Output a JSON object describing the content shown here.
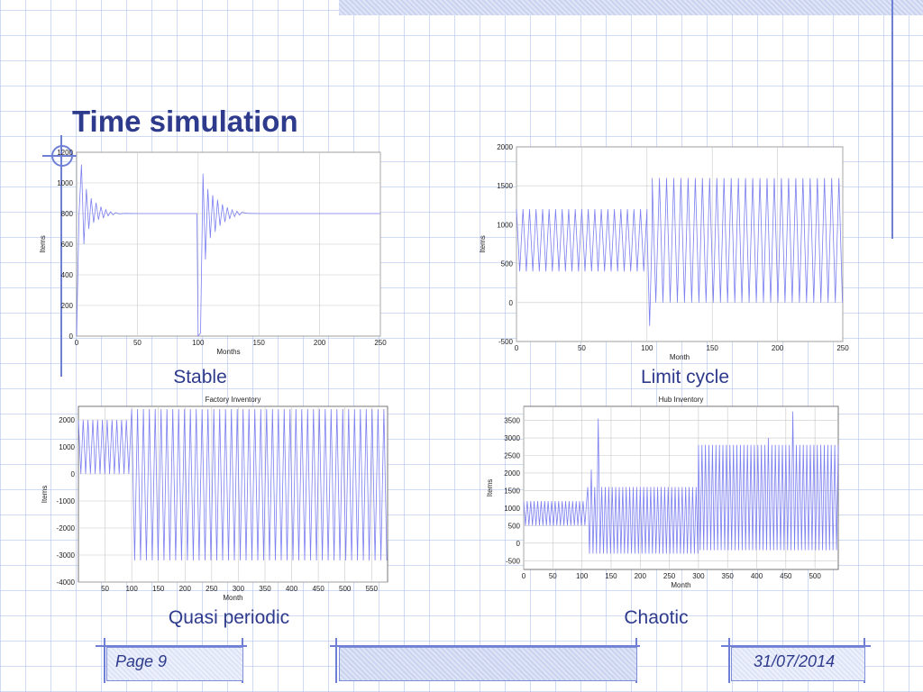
{
  "slide": {
    "title": "Time simulation",
    "page_label": "Page 9",
    "date": "31/07/2014",
    "accent_color": "#2e3a8c",
    "line_color": "#7b7ff0"
  },
  "chart_data": [
    {
      "type": "line",
      "caption": "Stable",
      "title": "",
      "xlabel": "Months",
      "ylabel": "Items",
      "xlim": [
        0,
        250
      ],
      "ylim": [
        0,
        1200
      ],
      "xticks": [
        0,
        50,
        100,
        150,
        200,
        250
      ],
      "yticks": [
        0,
        200,
        400,
        600,
        800,
        1000,
        1200
      ],
      "grid": true,
      "points": [
        [
          0,
          0
        ],
        [
          2,
          800
        ],
        [
          4,
          1120
        ],
        [
          6,
          600
        ],
        [
          8,
          960
        ],
        [
          10,
          700
        ],
        [
          12,
          900
        ],
        [
          14,
          740
        ],
        [
          16,
          870
        ],
        [
          18,
          760
        ],
        [
          20,
          845
        ],
        [
          22,
          770
        ],
        [
          24,
          825
        ],
        [
          26,
          785
        ],
        [
          28,
          812
        ],
        [
          30,
          792
        ],
        [
          32,
          806
        ],
        [
          35,
          798
        ],
        [
          40,
          801
        ],
        [
          50,
          800
        ],
        [
          60,
          800
        ],
        [
          80,
          800
        ],
        [
          99,
          800
        ],
        [
          100,
          0
        ],
        [
          102,
          20
        ],
        [
          104,
          1060
        ],
        [
          106,
          500
        ],
        [
          108,
          960
        ],
        [
          110,
          640
        ],
        [
          112,
          920
        ],
        [
          114,
          680
        ],
        [
          116,
          890
        ],
        [
          118,
          720
        ],
        [
          120,
          860
        ],
        [
          122,
          745
        ],
        [
          124,
          840
        ],
        [
          126,
          765
        ],
        [
          128,
          825
        ],
        [
          130,
          780
        ],
        [
          132,
          815
        ],
        [
          134,
          790
        ],
        [
          136,
          808
        ],
        [
          140,
          802
        ],
        [
          150,
          800
        ],
        [
          200,
          800
        ],
        [
          250,
          800
        ]
      ]
    },
    {
      "type": "line",
      "caption": "Limit cycle",
      "title": "",
      "xlabel": "Month",
      "ylabel": "Items",
      "xlim": [
        0,
        250
      ],
      "ylim": [
        -500,
        2000
      ],
      "xticks": [
        0,
        50,
        100,
        150,
        200,
        250
      ],
      "yticks": [
        -500,
        0,
        500,
        1000,
        1500,
        2000
      ],
      "grid": true,
      "segments": [
        {
          "x_start": 0,
          "x_end": 100,
          "period": 5,
          "min": 400,
          "max": 1200
        },
        {
          "x_start": 100,
          "x_end": 104,
          "period": 4,
          "min": -300,
          "max": 1000
        },
        {
          "x_start": 104,
          "x_end": 250,
          "period": 5.5,
          "min": 0,
          "max": 1600
        }
      ]
    },
    {
      "type": "line",
      "caption": "Quasi periodic",
      "title": "Factory Inventory",
      "xlabel": "Month",
      "ylabel": "Items",
      "xlim": [
        0,
        580
      ],
      "ylim": [
        -4000,
        2500
      ],
      "xticks": [
        50,
        100,
        150,
        200,
        250,
        300,
        350,
        400,
        450,
        500,
        550
      ],
      "yticks": [
        -4000,
        -3000,
        -2000,
        -1000,
        0,
        1000,
        2000
      ],
      "grid": true,
      "segments": [
        {
          "x_start": 0,
          "x_end": 100,
          "period": 9,
          "min": 0,
          "max": 2000
        },
        {
          "x_start": 100,
          "x_end": 580,
          "period": 11,
          "min": -3200,
          "max": 2400
        }
      ]
    },
    {
      "type": "line",
      "caption": "Chaotic",
      "title": "Hub Inventory",
      "xlabel": "Month",
      "ylabel": "Items",
      "xlim": [
        0,
        540
      ],
      "ylim": [
        -750,
        3900
      ],
      "xticks": [
        0,
        50,
        100,
        150,
        200,
        250,
        300,
        350,
        400,
        450,
        500
      ],
      "yticks": [
        -500,
        0,
        500,
        1000,
        1500,
        2000,
        2500,
        3000,
        3500
      ],
      "grid": true,
      "segments": [
        {
          "x_start": 0,
          "x_end": 110,
          "period": 6,
          "min": 500,
          "max": 1200
        },
        {
          "x_start": 110,
          "x_end": 300,
          "period": 6,
          "min": -300,
          "max": 1600
        },
        {
          "x_start": 300,
          "x_end": 540,
          "period": 6,
          "min": -200,
          "max": 2800
        }
      ],
      "peaks": [
        [
          116,
          2100
        ],
        [
          128,
          3550
        ],
        [
          420,
          3000
        ],
        [
          463,
          3750
        ]
      ]
    }
  ]
}
